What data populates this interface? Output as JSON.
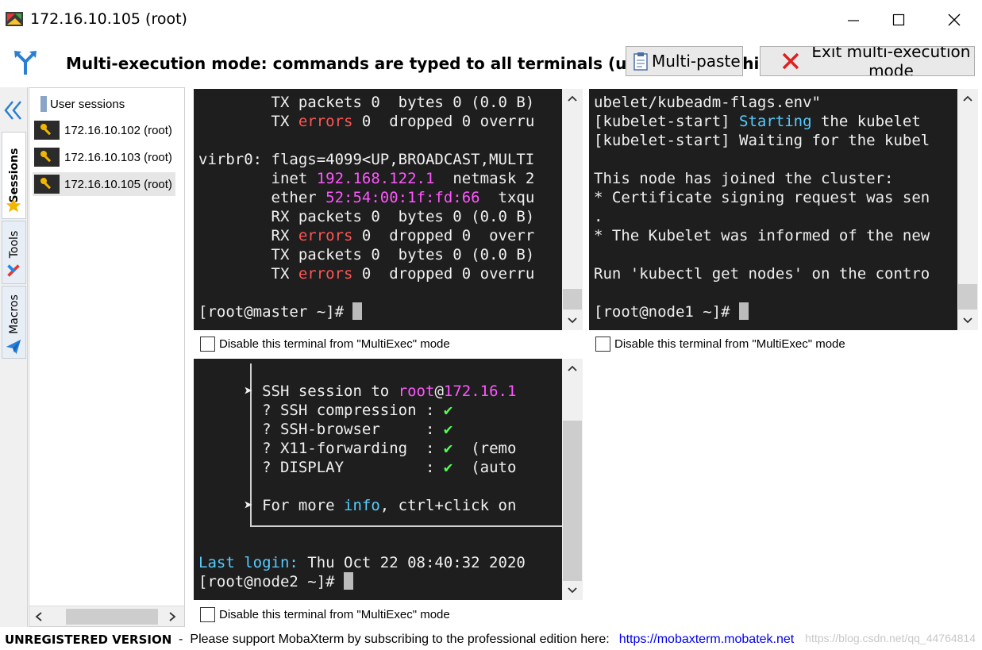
{
  "window": {
    "title": "172.16.10.105 (root)"
  },
  "banner": {
    "text": "Multi-execution mode: commands are typed to all terminals (use [Ctrl] + [Shift] to disable)",
    "multipaste_label": "Multi-paste",
    "exit_label": "Exit multi-execution mode"
  },
  "vtabs": {
    "sessions": "Sessions",
    "tools": "Tools",
    "macros": "Macros"
  },
  "sessions": {
    "root_label": "User sessions",
    "items": [
      {
        "label": "172.16.10.102 (root)"
      },
      {
        "label": "172.16.10.103 (root)"
      },
      {
        "label": "172.16.10.105 (root)"
      }
    ]
  },
  "terminals": {
    "master": {
      "lines": [
        [
          {
            "t": "        TX packets 0  bytes 0 (0.0 B)"
          }
        ],
        [
          {
            "t": "        TX "
          },
          {
            "t": "errors",
            "c": "c-red"
          },
          {
            "t": " 0  dropped 0 overru"
          }
        ],
        [
          {
            "t": ""
          }
        ],
        [
          {
            "t": "virbr0: flags=4099<UP,BROADCAST,MULTI"
          }
        ],
        [
          {
            "t": "        inet "
          },
          {
            "t": "192.168.122.1",
            "c": "c-pink"
          },
          {
            "t": "  netmask 2"
          }
        ],
        [
          {
            "t": "        ether "
          },
          {
            "t": "52:54:00:1f:fd:66",
            "c": "c-pink"
          },
          {
            "t": "  txqu"
          }
        ],
        [
          {
            "t": "        RX packets 0  bytes 0 (0.0 B)"
          }
        ],
        [
          {
            "t": "        RX "
          },
          {
            "t": "errors",
            "c": "c-red"
          },
          {
            "t": " 0  dropped 0  overr"
          }
        ],
        [
          {
            "t": "        TX packets 0  bytes 0 (0.0 B)"
          }
        ],
        [
          {
            "t": "        TX "
          },
          {
            "t": "errors",
            "c": "c-red"
          },
          {
            "t": " 0  dropped 0 overru"
          }
        ],
        [
          {
            "t": ""
          }
        ],
        [
          {
            "t": "[root@master ~]# "
          },
          {
            "cursor": true
          }
        ]
      ],
      "disable_label": "Disable this terminal from \"MultiExec\" mode"
    },
    "node1": {
      "lines": [
        [
          {
            "t": "ubelet/kubeadm-flags.env\""
          }
        ],
        [
          {
            "t": "[kubelet-start] "
          },
          {
            "t": "Starting",
            "c": "c-cyan"
          },
          {
            "t": " the kubelet"
          }
        ],
        [
          {
            "t": "[kubelet-start] Waiting for the kubel"
          }
        ],
        [
          {
            "t": ""
          }
        ],
        [
          {
            "t": "This node has joined the cluster:"
          }
        ],
        [
          {
            "t": "* Certificate signing request was sen"
          }
        ],
        [
          {
            "t": "."
          }
        ],
        [
          {
            "t": "* The Kubelet was informed of the new"
          }
        ],
        [
          {
            "t": ""
          }
        ],
        [
          {
            "t": "Run 'kubectl get nodes' on the contro"
          }
        ],
        [
          {
            "t": ""
          }
        ],
        [
          {
            "t": "[root@node1 ~]# "
          },
          {
            "cursor": true
          }
        ]
      ],
      "disable_label": "Disable this terminal from \"MultiExec\" mode"
    },
    "node2": {
      "lines": [
        [
          {
            "t": ""
          }
        ],
        [
          {
            "t": "     ➤ SSH session to "
          },
          {
            "t": "root",
            "c": "c-pink"
          },
          {
            "t": "@"
          },
          {
            "t": "172.16.1",
            "c": "c-pink"
          }
        ],
        [
          {
            "t": "       ? SSH compression : "
          },
          {
            "t": "✔",
            "c": "c-green"
          }
        ],
        [
          {
            "t": "       ? SSH-browser     : "
          },
          {
            "t": "✔",
            "c": "c-green"
          }
        ],
        [
          {
            "t": "       ? X11-forwarding  : "
          },
          {
            "t": "✔",
            "c": "c-green"
          },
          {
            "t": "  (remo"
          }
        ],
        [
          {
            "t": "       ? DISPLAY         : "
          },
          {
            "t": "✔",
            "c": "c-green"
          },
          {
            "t": "  (auto"
          }
        ],
        [
          {
            "t": ""
          }
        ],
        [
          {
            "t": "     ➤ For more "
          },
          {
            "t": "info",
            "c": "c-cyan"
          },
          {
            "t": ", ctrl+click on"
          }
        ],
        [
          {
            "t": ""
          }
        ],
        [
          {
            "t": ""
          }
        ],
        [
          {
            "t": "Last login:",
            "c": "c-cyan"
          },
          {
            "t": " Thu Oct 22 08:40:32 2020"
          }
        ],
        [
          {
            "t": "[root@node2 ~]# "
          },
          {
            "cursor": true
          }
        ]
      ],
      "disable_label": "Disable this terminal from \"MultiExec\" mode"
    }
  },
  "status": {
    "unregistered": "UNREGISTERED VERSION",
    "message": "  -  Please support MobaXterm by subscribing to the professional edition here:",
    "link": "https://mobaxterm.mobatek.net",
    "watermark": "https://blog.csdn.net/qq_44764814"
  },
  "colors": {
    "terminal_bg": "#1e1e1e",
    "accent_blue": "#2a7fd4",
    "close_red": "#e02020"
  }
}
